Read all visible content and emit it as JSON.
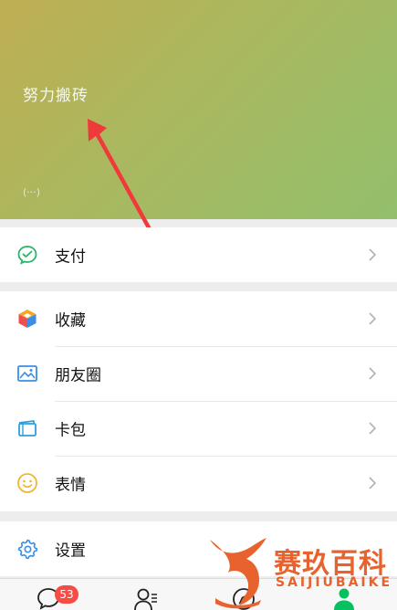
{
  "profile": {
    "nickname": "努力搬砖",
    "status": "(···)"
  },
  "menu": {
    "pay": "支付",
    "favorites": "收藏",
    "moments": "朋友圈",
    "cards": "卡包",
    "stickers": "表情",
    "settings": "设置"
  },
  "tabbar": {
    "chats_badge": "53"
  },
  "watermark": {
    "cn": "赛玖百科",
    "en": "SAIJIUBAIKE"
  },
  "colors": {
    "header_gradient": [
      "#bfae53",
      "#93bf6c"
    ],
    "annotation_arrow": "#f0393a",
    "badge": "#f74b43",
    "watermark": "#e7622d"
  }
}
